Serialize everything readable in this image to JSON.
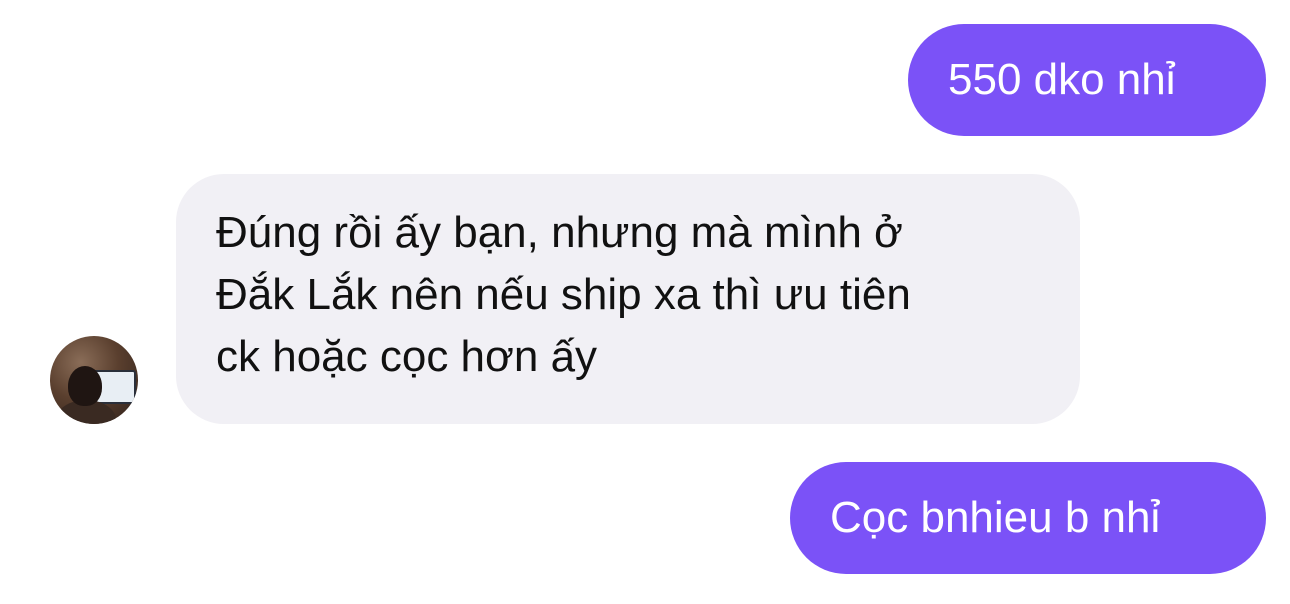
{
  "conversation": {
    "messages": [
      {
        "sender": "me",
        "text": "550 dko nhỉ"
      },
      {
        "sender": "contact",
        "lines": [
          "Đúng rồi ấy bạn, nhưng mà mình ở",
          "Đắk Lắk nên nếu ship xa thì ưu tiên",
          "ck hoặc cọc hơn ấy"
        ]
      },
      {
        "sender": "me",
        "text": "Cọc bnhieu b nhỉ"
      }
    ]
  },
  "colors": {
    "sent_bubble": "#7b52f7",
    "received_bubble": "#f1f0f5",
    "sent_text": "#ffffff",
    "received_text": "#111111"
  },
  "icons": {
    "contact_avatar": "contact-avatar-photo"
  }
}
